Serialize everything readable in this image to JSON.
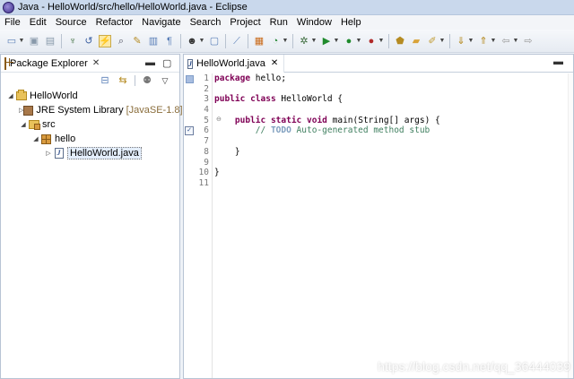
{
  "window": {
    "title": "Java - HelloWorld/src/hello/HelloWorld.java - Eclipse"
  },
  "menu": [
    "File",
    "Edit",
    "Source",
    "Refactor",
    "Navigate",
    "Search",
    "Project",
    "Run",
    "Window",
    "Help"
  ],
  "package_explorer": {
    "tab_label": "Package Explorer",
    "tree": {
      "project": "HelloWorld",
      "jre": "JRE System Library",
      "jre_version": "[JavaSE-1.8]",
      "src": "src",
      "package": "hello",
      "file": "HelloWorld.java"
    }
  },
  "editor": {
    "tab_label": "HelloWorld.java",
    "lines": [
      "1",
      "2",
      "3",
      "4",
      "5",
      "6",
      "7",
      "8",
      "9",
      "10",
      "11"
    ],
    "code": {
      "l1_kw": "package",
      "l1_rest": " hello;",
      "l3_kw1": "public",
      "l3_kw2": "class",
      "l3_rest": " HelloWorld {",
      "l5_indent": "    ",
      "l5_kw1": "public",
      "l5_kw2": "static",
      "l5_kw3": "void",
      "l5_rest": " main(String[] args) {",
      "l6_indent": "        ",
      "l6_slashes": "// ",
      "l6_todo": "TODO",
      "l6_rest": " Auto-generated method stub",
      "l8": "    }",
      "l10": "}"
    }
  },
  "watermark": "https://blog.csdn.net/qq_36444039",
  "colors": {
    "keyword": "#7f0055",
    "comment": "#3f7f5f",
    "todo": "#7f9fbf",
    "selection": "#e4eefc"
  }
}
